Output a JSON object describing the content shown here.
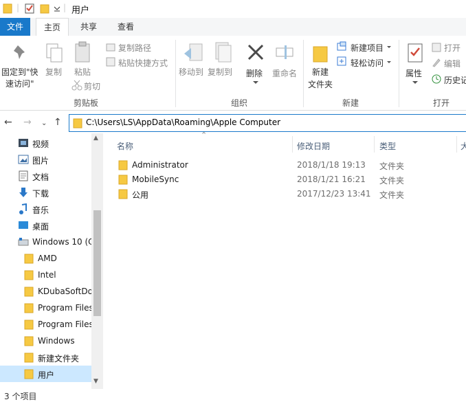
{
  "window": {
    "title": "用户"
  },
  "ribbon_tabs": [
    "文件",
    "主页",
    "共享",
    "查看"
  ],
  "ribbon": {
    "clipboard": {
      "pin_label_line1": "固定到\"快",
      "pin_label_line2": "速访问\"",
      "copy_label": "复制",
      "paste_label": "粘贴",
      "copy_path_label": "复制路径",
      "paste_shortcut_label": "粘贴快捷方式",
      "cut_label": "剪切",
      "group_label": "剪贴板"
    },
    "organize": {
      "move_to_label": "移动到",
      "copy_to_label": "复制到",
      "delete_label": "删除",
      "rename_label": "重命名",
      "group_label": "组织"
    },
    "new": {
      "new_folder_line1": "新建",
      "new_folder_line2": "文件夹",
      "new_item_label": "新建项目",
      "easy_access_label": "轻松访问",
      "group_label": "新建"
    },
    "open": {
      "properties_label": "属性",
      "open_label": "打开",
      "edit_label": "编辑",
      "history_label": "历史记",
      "group_label": "打开"
    }
  },
  "address": {
    "path": "C:\\Users\\LS\\AppData\\Roaming\\Apple Computer"
  },
  "nav_pane": {
    "items": [
      "视频",
      "图片",
      "文档",
      "下载",
      "音乐",
      "桌面",
      "Windows 10 (C",
      "AMD",
      "Intel",
      "KDubaSoftDo",
      "Program Files",
      "Program Files",
      "Windows",
      "新建文件夹",
      "用户"
    ]
  },
  "columns": {
    "name": "名称",
    "date": "修改日期",
    "type": "类型",
    "size": "大"
  },
  "files": [
    {
      "name": "Administrator",
      "date": "2018/1/18 19:13",
      "type": "文件夹"
    },
    {
      "name": "MobileSync",
      "date": "2018/1/21 16:21",
      "type": "文件夹"
    },
    {
      "name": "公用",
      "date": "2017/12/23 13:41",
      "type": "文件夹"
    }
  ],
  "status": {
    "count": "3 个项目"
  },
  "colors": {
    "accent": "#1979ca",
    "folder": "#f6c943",
    "selection": "#cce8ff"
  }
}
